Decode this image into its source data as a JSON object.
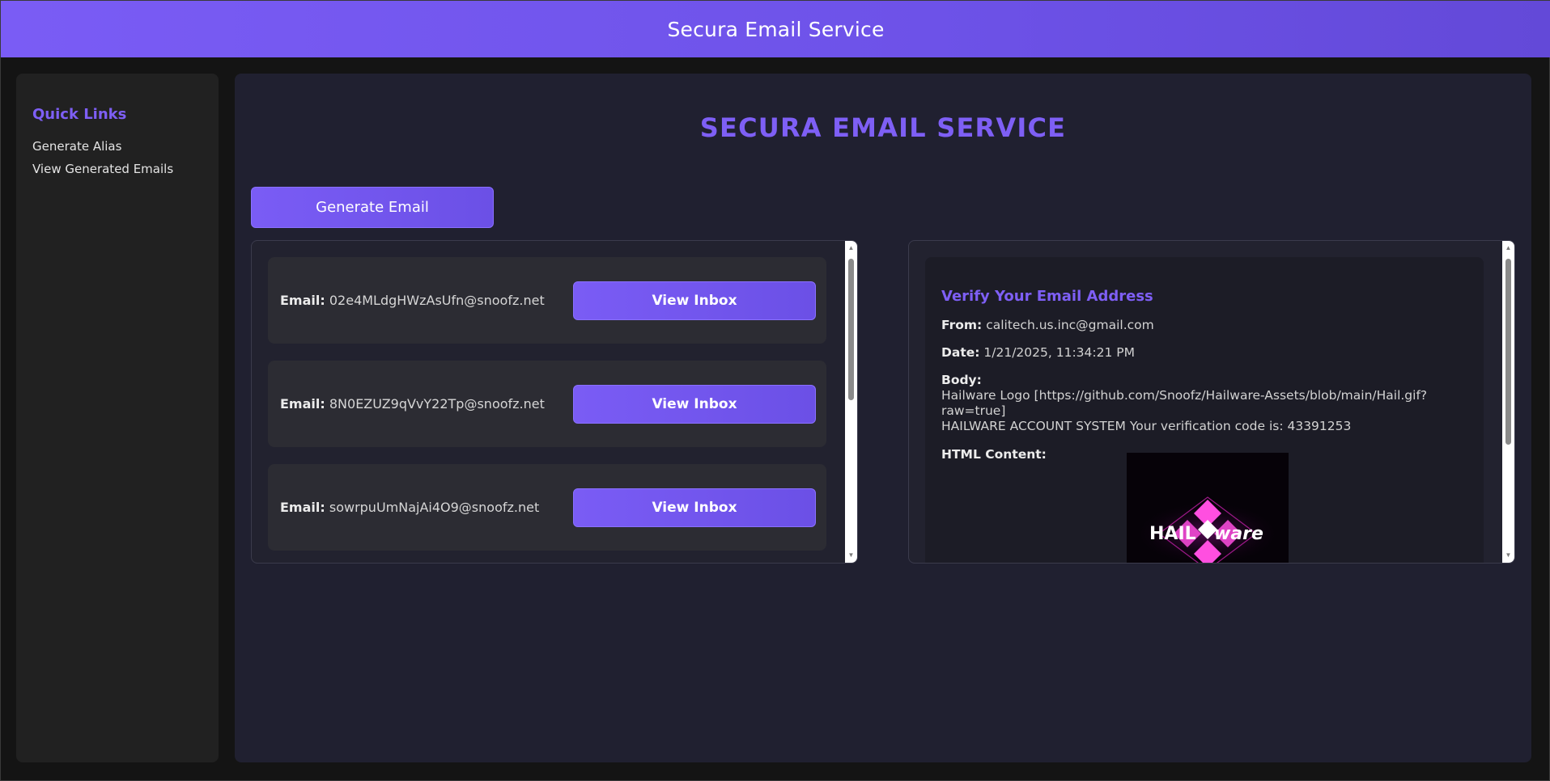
{
  "header": {
    "title": "Secura Email Service"
  },
  "sidebar": {
    "heading": "Quick Links",
    "links": [
      {
        "label": "Generate Alias"
      },
      {
        "label": "View Generated Emails"
      }
    ]
  },
  "main": {
    "title": "SECURA EMAIL SERVICE",
    "generate_label": "Generate Email"
  },
  "emails": [
    {
      "label": "Email:",
      "address": "02e4MLdgHWzAsUfn@snoofz.net",
      "button": "View Inbox"
    },
    {
      "label": "Email:",
      "address": "8N0EZUZ9qVvY22Tp@snoofz.net",
      "button": "View Inbox"
    },
    {
      "label": "Email:",
      "address": "sowrpuUmNajAi4O9@snoofz.net",
      "button": "View Inbox"
    }
  ],
  "message": {
    "subject": "Verify Your Email Address",
    "from_label": "From:",
    "from": "calitech.us.inc@gmail.com",
    "date_label": "Date:",
    "date": "1/21/2025, 11:34:21 PM",
    "body_label": "Body:",
    "body_line1": "Hailware Logo [https://github.com/Snoofz/Hailware-Assets/blob/main/Hail.gif?raw=true]",
    "body_line2": "HAILWARE ACCOUNT SYSTEM Your verification code is: 43391253",
    "html_label": "HTML Content:",
    "logo_text_a": "HAIL",
    "logo_text_b": "ware"
  },
  "colors": {
    "accent": "#7e5ff5",
    "header_gradient_start": "#7a5cf5",
    "header_gradient_end": "#6349d8",
    "logo_pink": "#ff3ad6"
  }
}
